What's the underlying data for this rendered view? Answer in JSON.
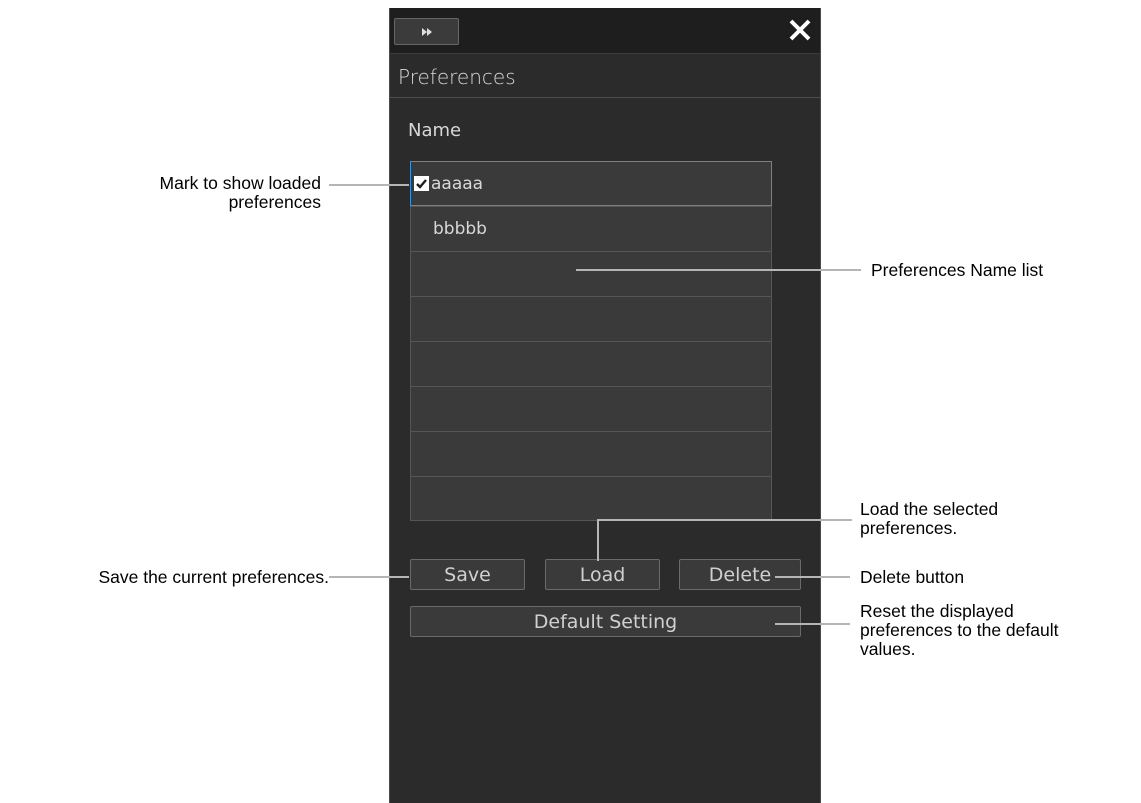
{
  "panel": {
    "close_symbol": "✕",
    "title": "Preferences",
    "name_header": "Name",
    "list": [
      {
        "label": "aaaaa",
        "checked": true,
        "selected": true
      },
      {
        "label": "bbbbb",
        "checked": false,
        "selected": false
      },
      {
        "label": "",
        "checked": false,
        "selected": false
      },
      {
        "label": "",
        "checked": false,
        "selected": false
      },
      {
        "label": "",
        "checked": false,
        "selected": false
      },
      {
        "label": "",
        "checked": false,
        "selected": false
      },
      {
        "label": "",
        "checked": false,
        "selected": false
      },
      {
        "label": "",
        "checked": false,
        "selected": false
      }
    ],
    "buttons": {
      "save": "Save",
      "load": "Load",
      "delete": "Delete",
      "default_setting": "Default Setting"
    }
  },
  "annotations": {
    "mark_loaded_1": "Mark to show loaded",
    "mark_loaded_2": "preferences",
    "name_list": "Preferences Name list",
    "load_1": "Load the selected",
    "load_2": "preferences.",
    "save": "Save the current preferences.",
    "delete": "Delete button",
    "reset_1": "Reset the displayed",
    "reset_2": "preferences to the default",
    "reset_3": "values."
  },
  "colors": {
    "panel_bg": "#2b2b2b",
    "selected_border": "#3c8fd8",
    "leader_line": "#b5b5b5"
  }
}
